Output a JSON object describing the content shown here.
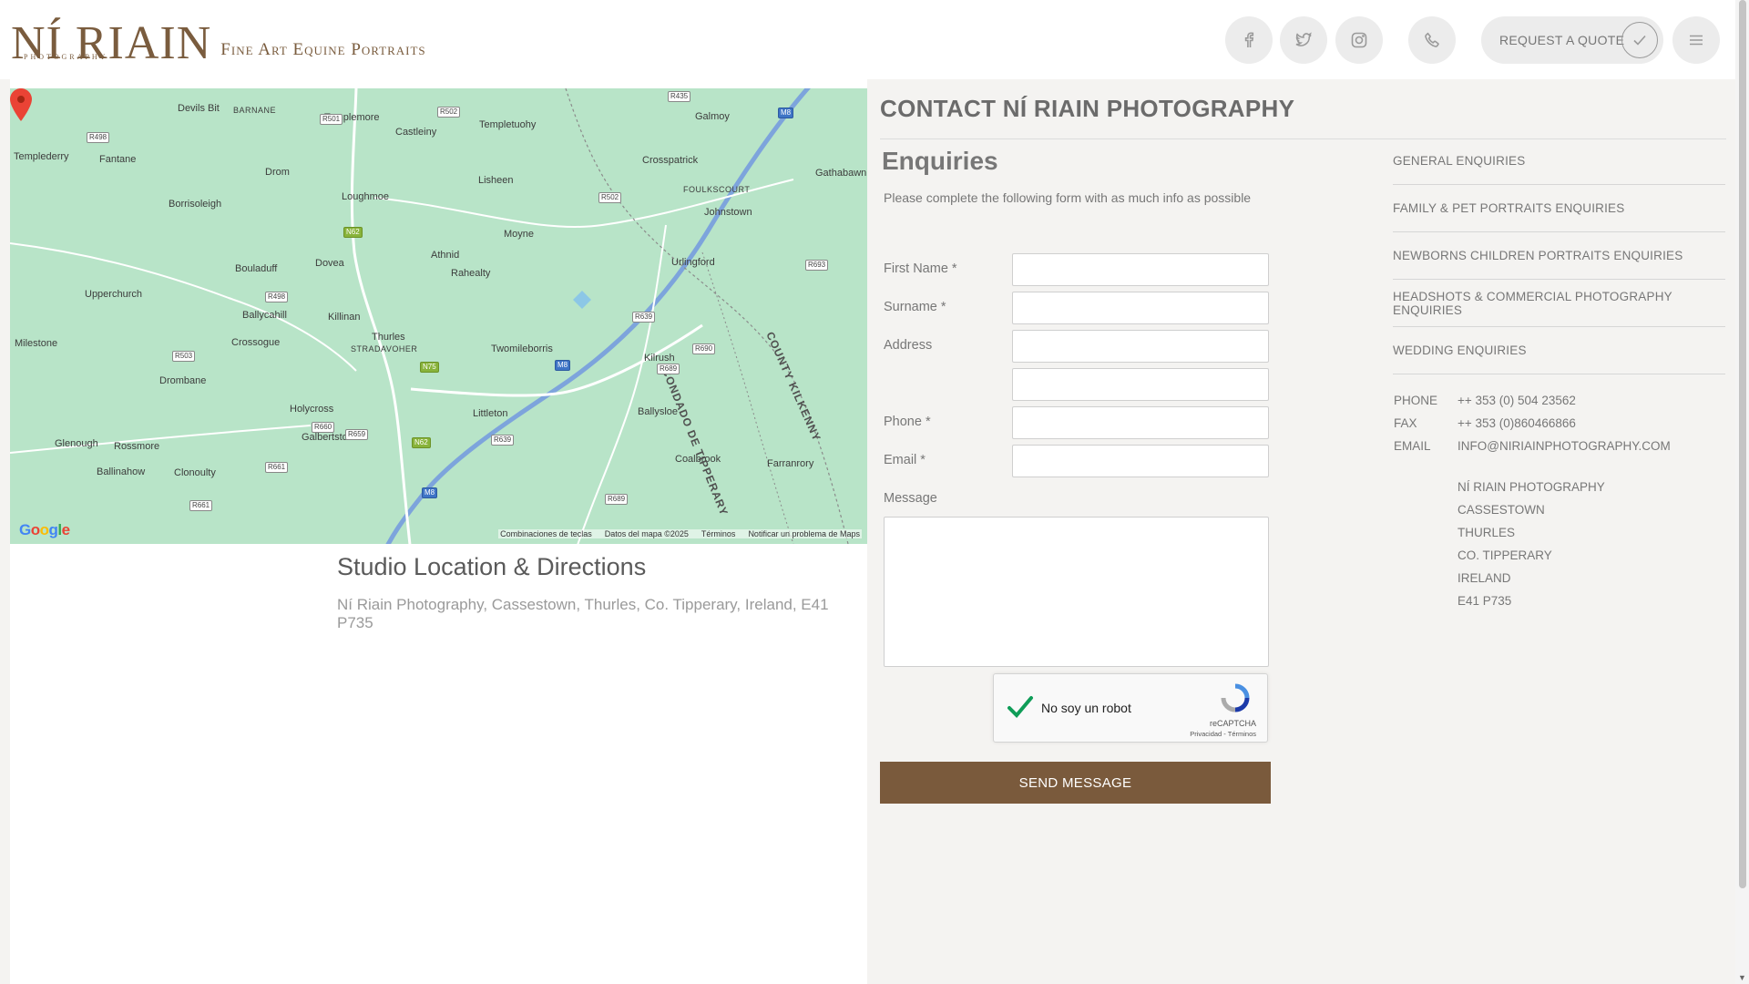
{
  "header": {
    "logo_main": "NÍ RIAIN",
    "logo_sub": "PHOTOGRAPHY",
    "tagline": "Fine Art Equine Portraits",
    "quote_label": "REQUEST A QUOTE"
  },
  "icons": {
    "facebook": "facebook-icon",
    "twitter": "twitter-icon",
    "instagram": "instagram-icon",
    "phone": "phone-icon",
    "check": "check-icon",
    "menu": "hamburger-menu-icon"
  },
  "map": {
    "labels": [
      "Devils Bit",
      "BARNANE",
      "Templemore",
      "Castleiny",
      "Templetuohy",
      "Galmoy",
      "Templederry",
      "Fantane",
      "Drom",
      "Lisheen",
      "Crosspatrick",
      "Gathabawn",
      "Borrisoleigh",
      "Loughmoe",
      "FOULKSCOURT",
      "Johnstown",
      "Moyne",
      "Athnid",
      "Rahealty",
      "Urlingford",
      "Bouladuff",
      "Dovea",
      "Upperchurch",
      "Ballycahill",
      "Killinan",
      "Milestone",
      "Crossogue",
      "Thurles",
      "STRADAVOHER",
      "Twomileborris",
      "Kilrush",
      "Drombane",
      "Holycross",
      "Littleton",
      "Ballysloe",
      "Galbertstown",
      "Glenough",
      "Rossmore",
      "Ballinahow",
      "Clonoulty",
      "Coalbrook",
      "Farranrory",
      "CONDADO DE TIPPERARY",
      "COUNTY KILKENNY"
    ],
    "footer": [
      "Combinaciones de teclas",
      "Datos del mapa ©2025",
      "Términos",
      "Notificar un problema de Maps"
    ],
    "google": "Google"
  },
  "studio": {
    "title": "Studio Location & Directions",
    "address": "Ní Riain Photography, Cassestown, Thurles, Co. Tipperary, Ireland, E41 P735"
  },
  "contact": {
    "title": "CONTACT NÍ RIAIN PHOTOGRAPHY",
    "enquiries_title": "Enquiries",
    "intro": "Please complete the following form with as much info as possible",
    "fields": {
      "first_name": "First Name *",
      "surname": "Surname *",
      "address": "Address",
      "phone": "Phone *",
      "email": "Email *",
      "message": "Message"
    },
    "recaptcha": {
      "label": "No soy un robot",
      "brand": "reCAPTCHA",
      "links": "Privacidad - Términos"
    },
    "send_label": "SEND MESSAGE"
  },
  "sidebar": {
    "items": [
      {
        "label": "GENERAL ENQUIRIES"
      },
      {
        "label": "FAMILY & PET PORTRAITS ENQUIRIES"
      },
      {
        "label": "NEWBORNS CHILDREN PORTRAITS ENQUIRIES"
      },
      {
        "label": "HEADSHOTS & COMMERCIAL PHOTOGRAPHY ENQUIRIES"
      },
      {
        "label": "WEDDING ENQUIRIES"
      }
    ],
    "phone_label": "PHONE",
    "phone_value": "++ 353 (0) 504 23562",
    "fax_label": "FAX",
    "fax_value": "++ 353 (0)860466866",
    "email_label": "EMAIL",
    "email_value": "INFO@NIRIAINPHOTOGRAPHY.COM",
    "address_lines": [
      "NÍ RIAIN PHOTOGRAPHY",
      "CASSESTOWN",
      "THURLES",
      "CO. TIPPERARY",
      "IRELAND",
      "E41 P735"
    ]
  },
  "colors": {
    "brand_brown": "#7a5a3c",
    "map_green": "#b8e4c8"
  }
}
